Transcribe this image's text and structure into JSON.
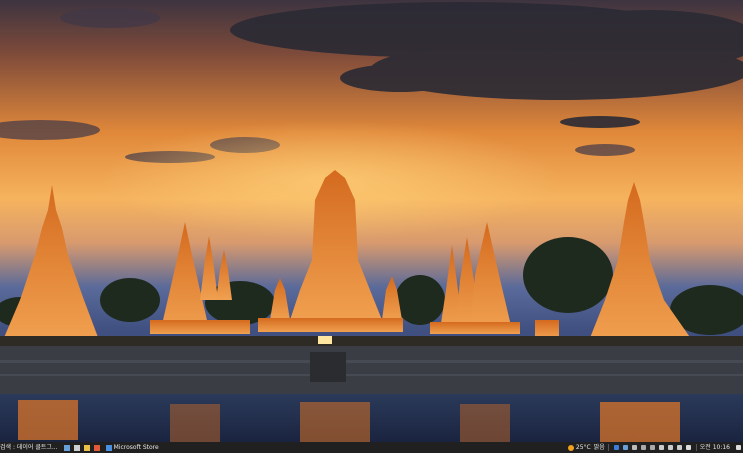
{
  "wallpaper": {
    "subject": "temple-ruins-sunset"
  },
  "taskbar": {
    "search_text": "검색 : 데이어 클트그...",
    "apps": [
      {
        "icon": "app-icon",
        "label": ""
      },
      {
        "icon": "app-icon",
        "label": ""
      },
      {
        "icon": "app-icon",
        "label": ""
      },
      {
        "icon": "app-icon",
        "label": ""
      },
      {
        "icon": "store-icon",
        "label": "Microsoft Store"
      }
    ],
    "weather": {
      "temp": "25°C",
      "condition": "맑음"
    },
    "clock": {
      "time": "오전 10:16"
    },
    "colors": {
      "bg": "#202020",
      "sun": "#f2a11f",
      "store": "#4a8fe0"
    }
  }
}
